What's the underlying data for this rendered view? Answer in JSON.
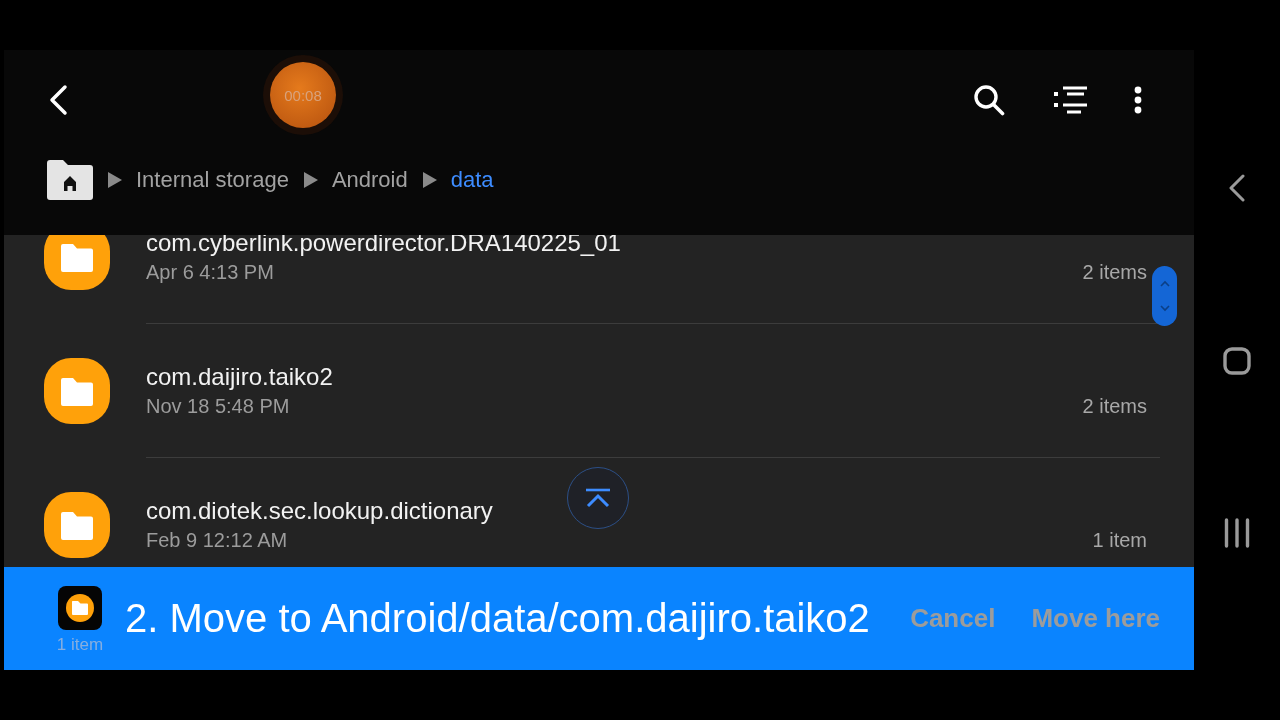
{
  "recording_timer": "00:08",
  "breadcrumb": [
    {
      "label": "Internal storage",
      "selected": false
    },
    {
      "label": "Android",
      "selected": false
    },
    {
      "label": "data",
      "selected": true
    }
  ],
  "files": [
    {
      "name": "com.cyberlink.powerdirector.DRA140225_01",
      "modified": "Apr 6 4:13 PM",
      "count": "2 items"
    },
    {
      "name": "com.daijiro.taiko2",
      "modified": "Nov 18 5:48 PM",
      "count": "2 items"
    },
    {
      "name": "com.diotek.sec.lookup.dictionary",
      "modified": "Feb 9 12:12 AM",
      "count": "1 item"
    }
  ],
  "move_bar": {
    "selection_count": "1 item",
    "caption": "2. Move to Android/data/com.daijiro.taiko2",
    "buttons": [
      {
        "label": "Cancel",
        "disabled": true
      },
      {
        "label": "Move here",
        "disabled": true
      }
    ]
  }
}
